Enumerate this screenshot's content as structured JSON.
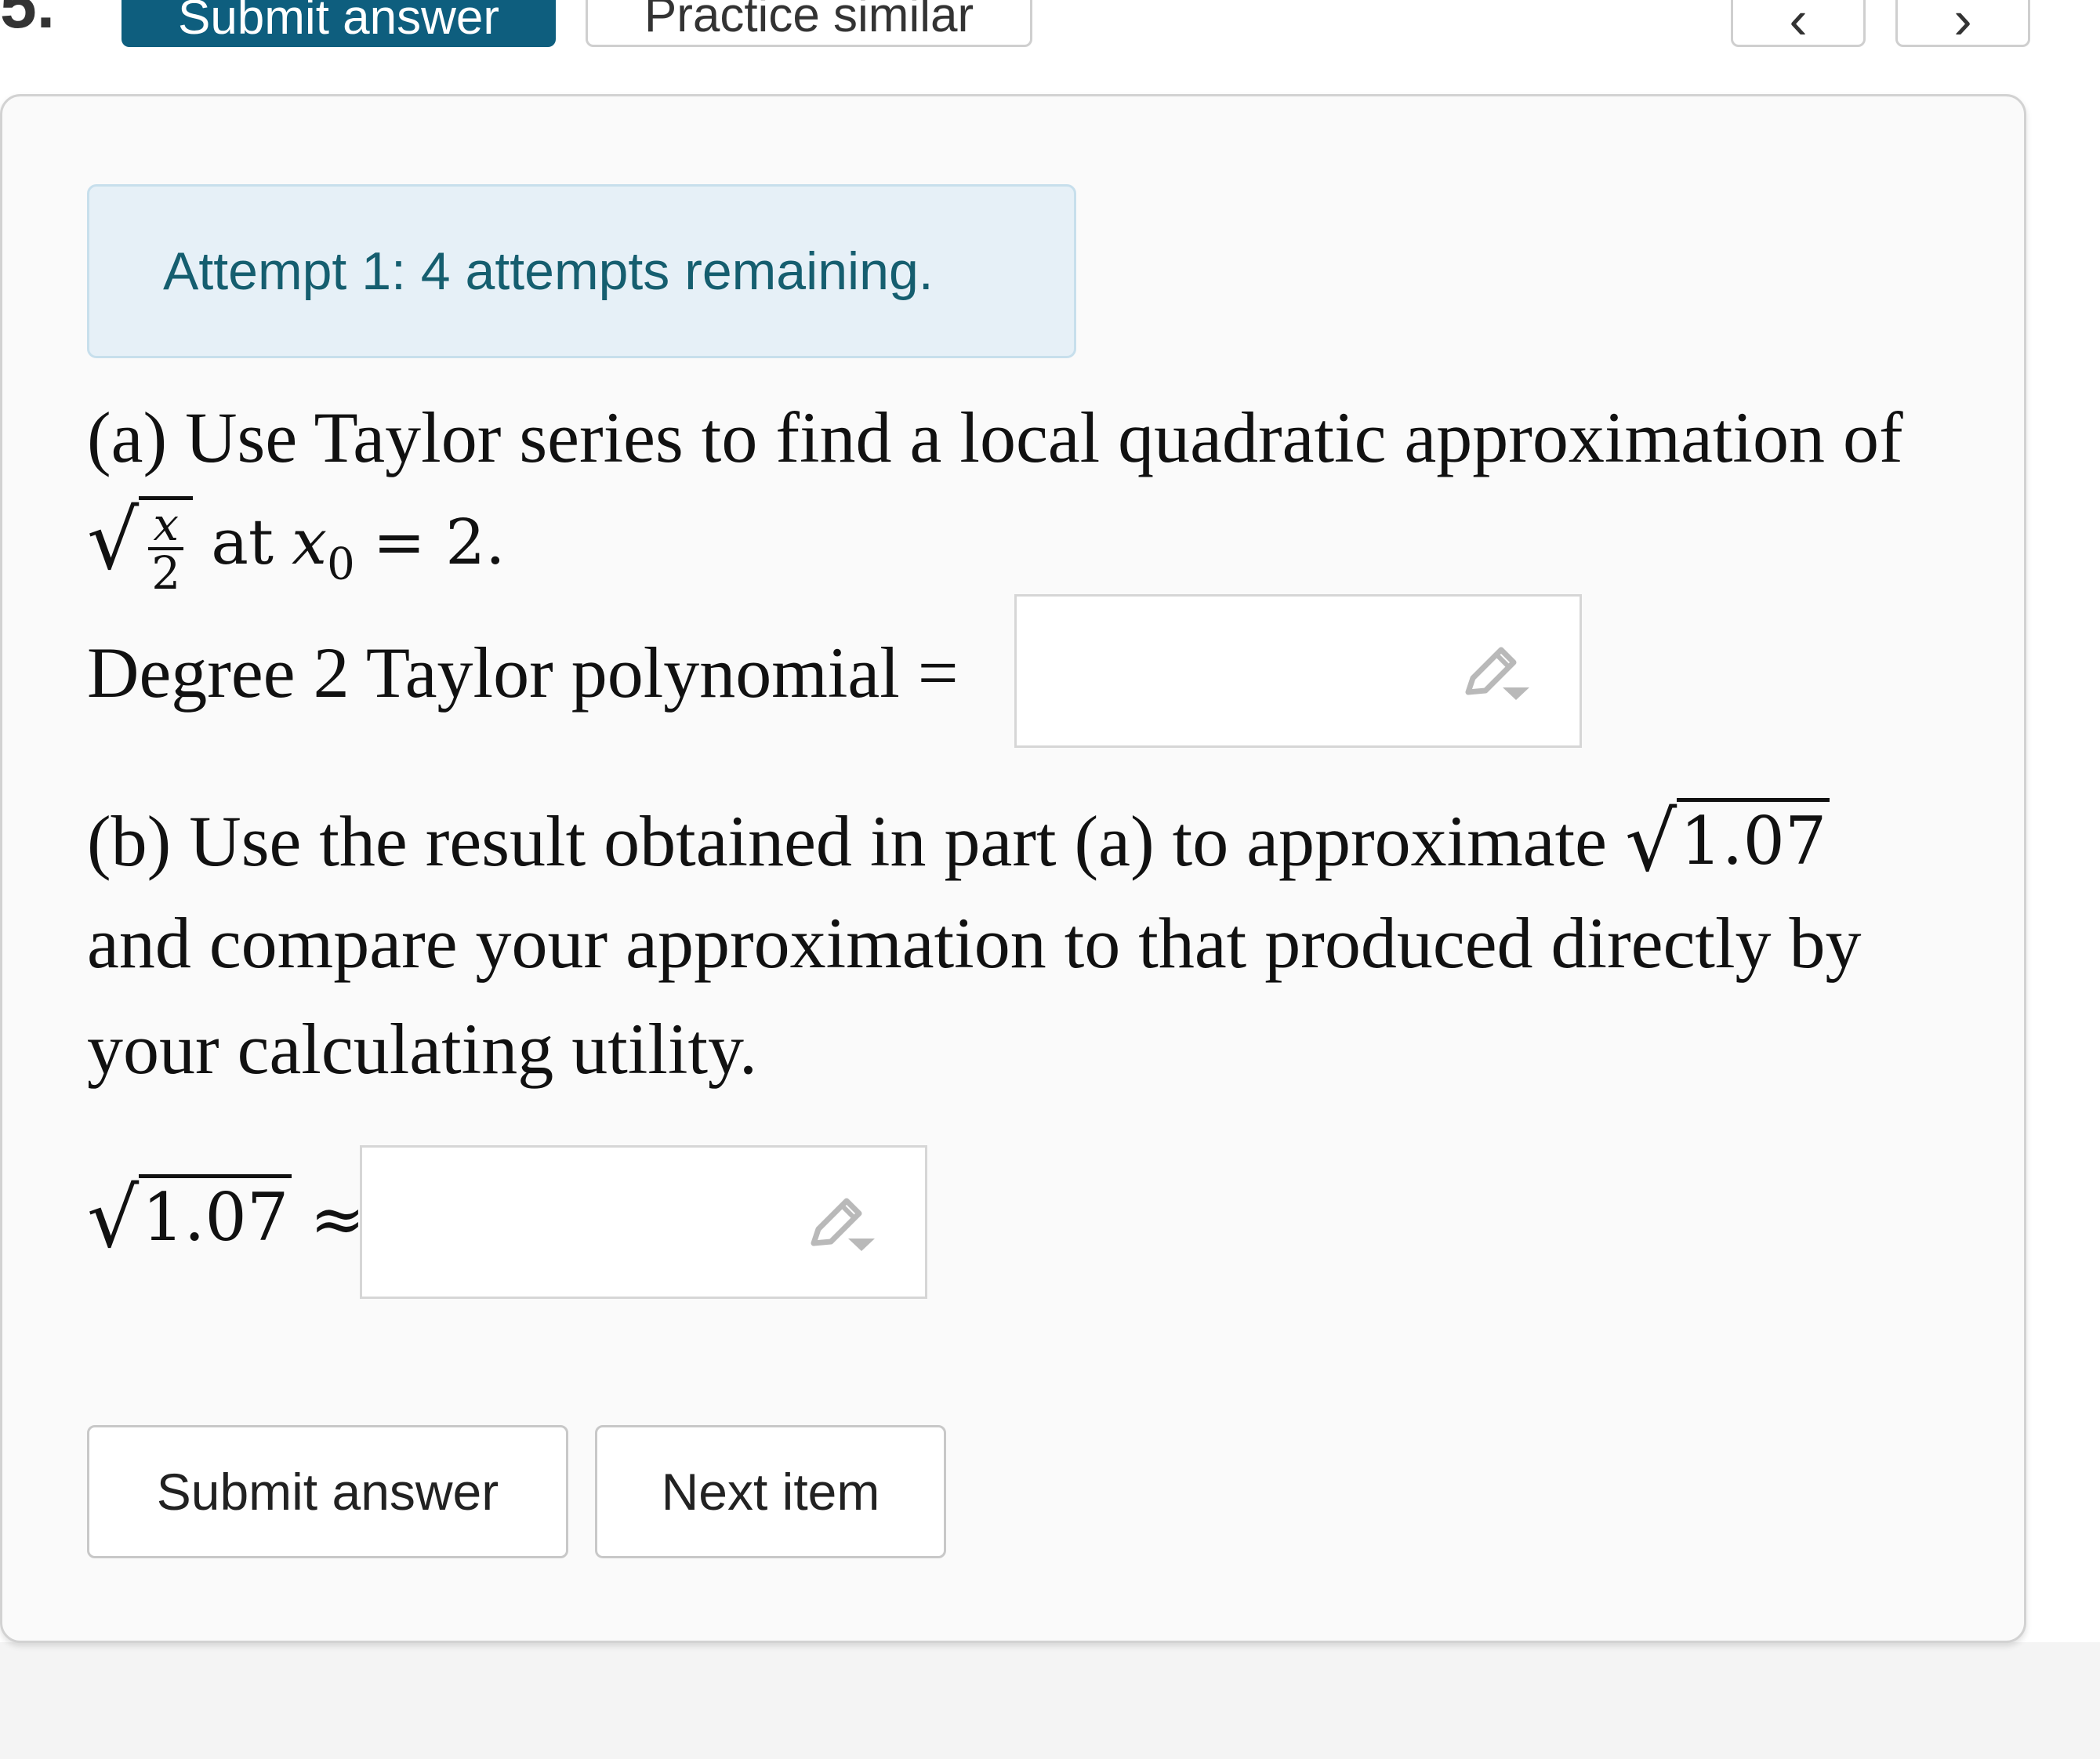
{
  "toolbar": {
    "question_number": "5.",
    "submit_label": "Submit answer",
    "practice_label": "Practice similar",
    "prev_glyph": "‹",
    "next_glyph": "›"
  },
  "alert": {
    "text": "Attempt 1: 4 attempts remaining."
  },
  "question": {
    "part_a_line1": "(a) Use Taylor series to find a local quadratic approximation of",
    "part_a_frac_num": "x",
    "part_a_frac_den": "2",
    "part_a_at": "at",
    "part_a_var": "x",
    "part_a_sub": "0",
    "part_a_eq": "= 2.",
    "degree_label": "Degree 2 Taylor polynomial =",
    "part_b_line1_prefix": "(b) Use the result obtained in part (a) to approximate",
    "part_b_radicand": "1.07",
    "part_b_line2": "and compare your approximation to that produced directly by",
    "part_b_line3": "your calculating utility.",
    "approx_radicand": "1.07",
    "approx_symbol": "≈"
  },
  "inputs": {
    "taylor_value": "",
    "approx_value": ""
  },
  "icons": {
    "answer_tool": "pencil-dropdown-icon"
  },
  "actions": {
    "submit_label": "Submit answer",
    "next_label": "Next item"
  },
  "colors": {
    "primary": "#0e5e7e",
    "alert_bg": "#e6f0f7",
    "alert_text": "#155e6f"
  }
}
